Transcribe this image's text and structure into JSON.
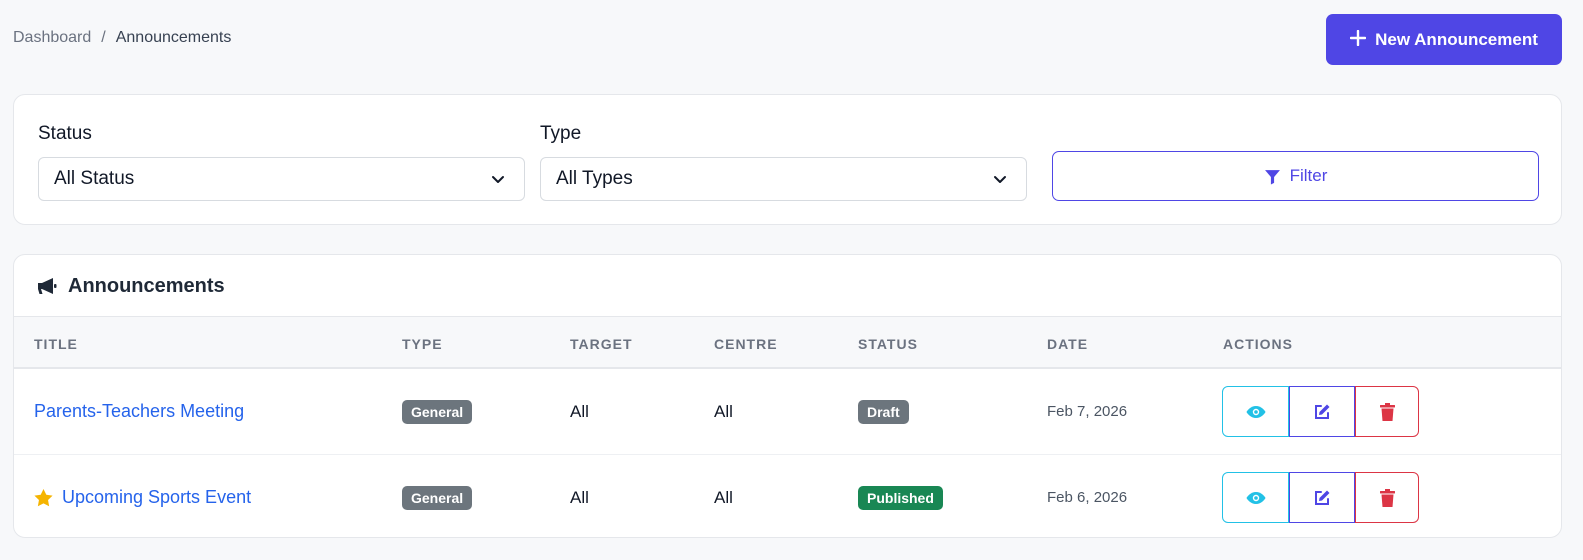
{
  "breadcrumb": {
    "parent": "Dashboard",
    "separator": "/",
    "current": "Announcements"
  },
  "header": {
    "new_button_label": "New Announcement",
    "new_button_icon": "plus-icon"
  },
  "filters": {
    "status_label": "Status",
    "status_value": "All Status",
    "type_label": "Type",
    "type_value": "All Types",
    "filter_button_label": "Filter",
    "filter_icon": "funnel-icon"
  },
  "table": {
    "title": "Announcements",
    "title_icon": "megaphone-icon",
    "columns": [
      "TITLE",
      "TYPE",
      "TARGET",
      "CENTRE",
      "STATUS",
      "DATE",
      "ACTIONS"
    ],
    "rows": [
      {
        "title": "Parents-Teachers Meeting",
        "pinned": false,
        "type": "General",
        "target": "All",
        "centre": "All",
        "status": "Draft",
        "status_color": "#6c757d",
        "date": "Feb 7, 2026"
      },
      {
        "title": "Upcoming Sports Event",
        "pinned": true,
        "type": "General",
        "target": "All",
        "centre": "All",
        "status": "Published",
        "status_color": "#198754",
        "date": "Feb 6, 2026"
      }
    ]
  },
  "colors": {
    "accent": "#4f46e5",
    "link": "#2563eb",
    "view": "#22c1e6",
    "delete": "#dc3545",
    "badge_gray": "#6c757d",
    "star": "#f5b400"
  }
}
